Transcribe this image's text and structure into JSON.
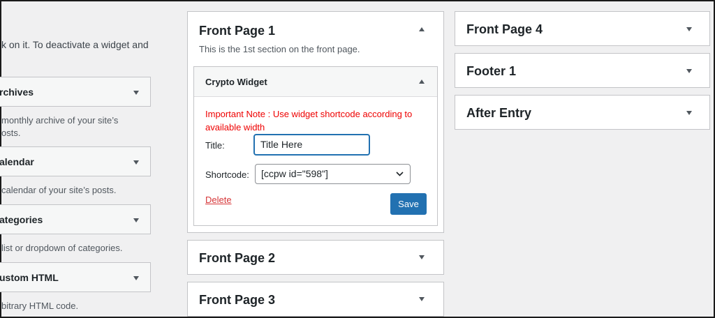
{
  "intro_text": "k on it. To deactivate a widget and",
  "available_widgets": [
    {
      "title": "rchives",
      "desc": [
        "monthly archive of your site’s",
        "osts."
      ]
    },
    {
      "title": "alendar",
      "desc": [
        "calendar of your site’s posts."
      ]
    },
    {
      "title": "ategories",
      "desc": [
        "list or dropdown of categories."
      ]
    },
    {
      "title": "ustom HTML",
      "desc": [
        "bitrary HTML code."
      ]
    }
  ],
  "front_page_1": {
    "title": "Front Page 1",
    "description": "This is the 1st section on the front page.",
    "widget": {
      "title": "Crypto Widget",
      "note_line1": "Important Note : Use widget shortcode according to",
      "note_line2": "available width",
      "title_label": "Title:",
      "title_value": "Title Here",
      "shortcode_label": "Shortcode:",
      "shortcode_value": "[ccpw id=\"598\"]",
      "delete_label": "Delete",
      "save_label": "Save"
    }
  },
  "front_page_2": {
    "title": "Front Page 2"
  },
  "front_page_3": {
    "title": "Front Page 3"
  },
  "front_page_4": {
    "title": "Front Page 4"
  },
  "footer_1": {
    "title": "Footer 1"
  },
  "after_entry": {
    "title": "After Entry"
  },
  "colors": {
    "accent": "#2271b1",
    "note_red": "#e00000",
    "delete_red": "#d63638",
    "background": "#f0f0f1"
  }
}
